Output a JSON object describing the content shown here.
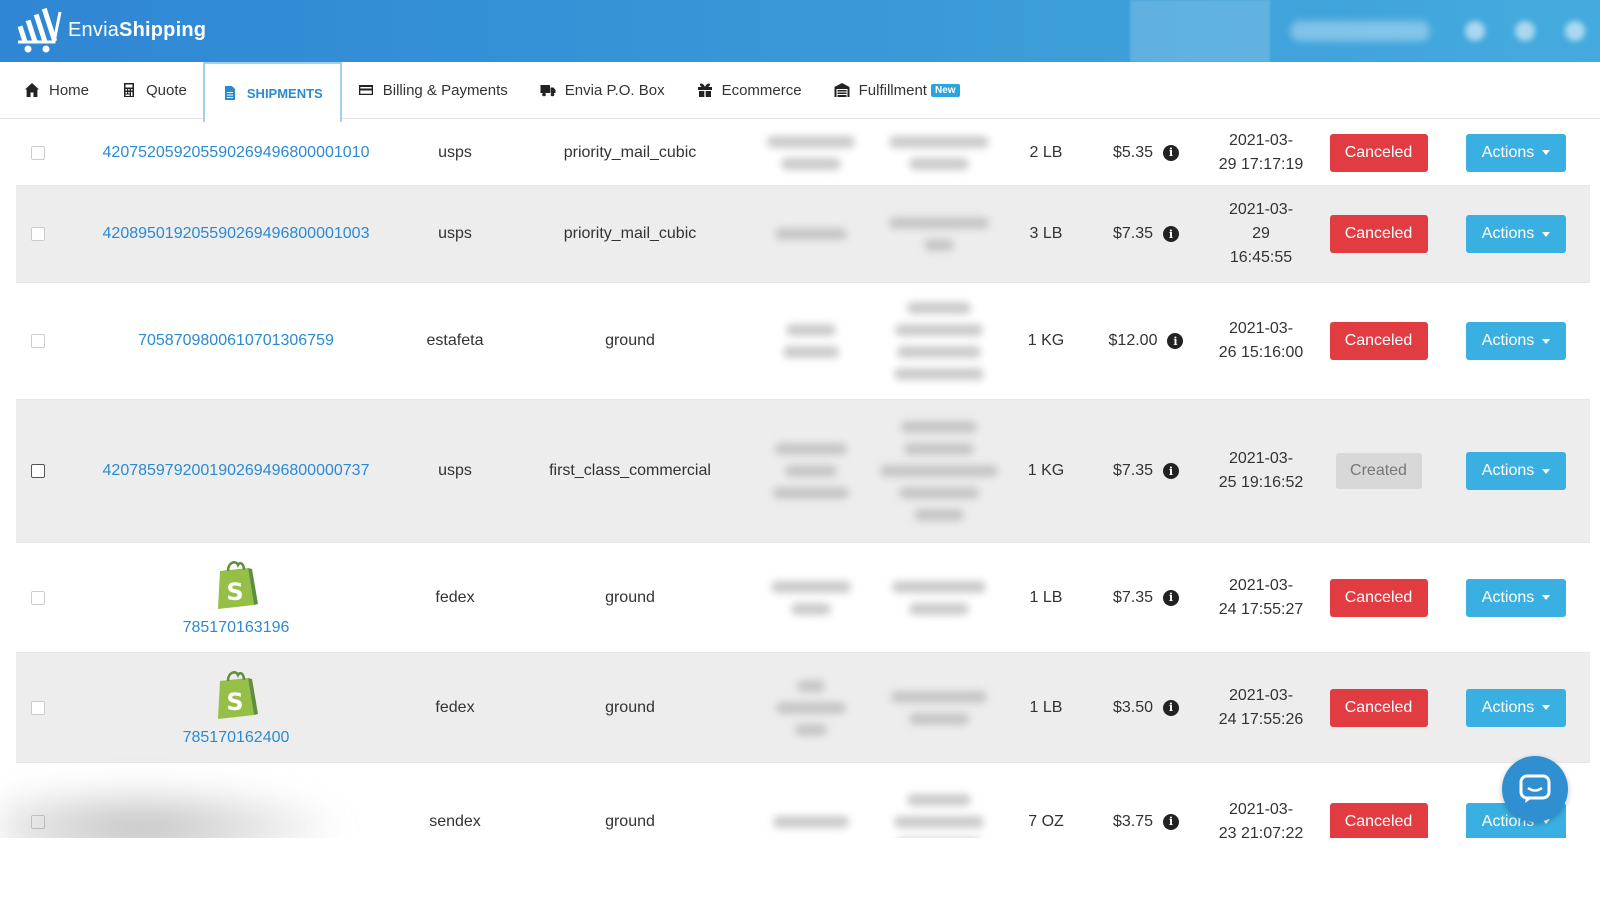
{
  "brand": {
    "name_light": "Envia",
    "name_bold": "Shipping"
  },
  "nav": {
    "items": [
      {
        "label": "Home",
        "icon": "home-icon"
      },
      {
        "label": "Quote",
        "icon": "calculator-icon"
      },
      {
        "label": "SHIPMENTS",
        "icon": "document-icon",
        "active": true
      },
      {
        "label": "Billing & Payments",
        "icon": "credit-card-icon"
      },
      {
        "label": "Envia P.O. Box",
        "icon": "truck-icon"
      },
      {
        "label": "Ecommerce",
        "icon": "gift-box-icon"
      },
      {
        "label": "Fulfillment",
        "icon": "warehouse-icon",
        "badge": "New"
      }
    ]
  },
  "shipments": [
    {
      "tracking": "420752059205590269496800001010",
      "carrier": "usps",
      "service": "priority_mail_cubic",
      "weight": "2 LB",
      "price": "$5.35",
      "date": [
        "2021-03-",
        "29 17:17:19"
      ],
      "status": "Canceled",
      "actions": "Actions",
      "shopify": false
    },
    {
      "tracking": "420895019205590269496800001003",
      "carrier": "usps",
      "service": "priority_mail_cubic",
      "weight": "3 LB",
      "price": "$7.35",
      "date": [
        "2021-03-",
        "29",
        "16:45:55"
      ],
      "status": "Canceled",
      "actions": "Actions",
      "shopify": false
    },
    {
      "tracking": "705870980061070130​6759",
      "carrier": "estafeta",
      "service": "ground",
      "weight": "1 KG",
      "price": "$12.00",
      "date": [
        "2021-03-",
        "26 15:16:00"
      ],
      "status": "Canceled",
      "actions": "Actions",
      "shopify": false
    },
    {
      "tracking": "420785979200190269496800000737",
      "carrier": "usps",
      "service": "first_class_commercial",
      "weight": "1 KG",
      "price": "$7.35",
      "date": [
        "2021-03-",
        "25 19:16:52"
      ],
      "status": "Created",
      "actions": "Actions",
      "shopify": false
    },
    {
      "tracking": "785170163196",
      "carrier": "fedex",
      "service": "ground",
      "weight": "1 LB",
      "price": "$7.35",
      "date": [
        "2021-03-",
        "24 17:55:27"
      ],
      "status": "Canceled",
      "actions": "Actions",
      "shopify": true
    },
    {
      "tracking": "785170162400",
      "carrier": "fedex",
      "service": "ground",
      "weight": "1 LB",
      "price": "$3.50",
      "date": [
        "2021-03-",
        "24 17:55:26"
      ],
      "status": "Canceled",
      "actions": "Actions",
      "shopify": true
    },
    {
      "tracking": "",
      "carrier": "sendex",
      "service": "ground",
      "weight": "7 OZ",
      "price": "$3.75",
      "date": [
        "2021-03-",
        "23 21:07:22"
      ],
      "status": "Canceled",
      "actions": "Actions",
      "shopify": false
    }
  ],
  "colors": {
    "brand_blue": "#2f86d4",
    "link": "#2a8ad3",
    "canceled": "#e23c43",
    "actions": "#3ab0e2",
    "created": "#d8d8d8"
  }
}
